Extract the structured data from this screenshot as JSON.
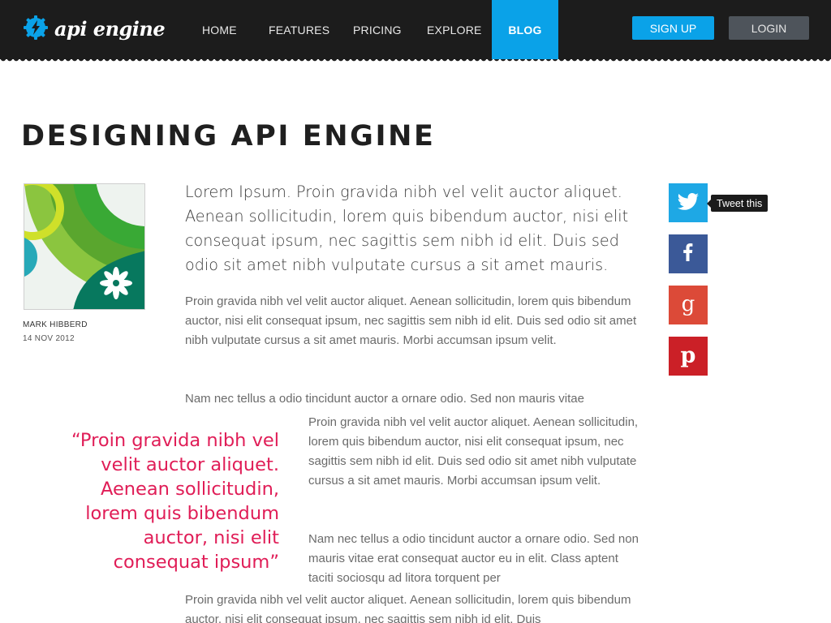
{
  "header": {
    "logo_text": "api engine",
    "nav": [
      {
        "label": "HOME"
      },
      {
        "label": "FEATURES"
      },
      {
        "label": "PRICING"
      },
      {
        "label": "EXPLORE"
      },
      {
        "label": "BLOG",
        "active": true
      }
    ],
    "signup_label": "SIGN UP",
    "login_label": "LOGIN"
  },
  "article": {
    "title": "DESIGNING API ENGINE",
    "author": "MARK HIBBERD",
    "date": "14 NOV 2012",
    "lead": "Lorem Ipsum. Proin gravida nibh vel velit auctor aliquet. Aenean sollicitudin, lorem quis bibendum auctor, nisi elit consequat ipsum, nec sagittis sem nibh id elit. Duis sed odio sit amet nibh vulputate cursus a sit amet mauris.",
    "paragraphs": [
      "Proin gravida nibh vel velit auctor aliquet. Aenean sollicitudin, lorem quis bibendum auctor, nisi elit consequat ipsum, nec sagittis sem nibh id elit. Duis sed odio sit amet nibh vulputate cursus a sit amet mauris. Morbi accumsan ipsum velit.",
      "Nam nec tellus a odio tincidunt auctor a ornare odio. Sed non  mauris vitae",
      "Proin gravida nibh vel velit auctor aliquet. Aenean sollicitudin, lorem quis bibendum auctor, nisi elit consequat ipsum, nec sagittis sem nibh id elit. Duis sed odio sit amet nibh vulputate cursus a sit amet mauris. Morbi accumsan ipsum velit.",
      "Nam nec tellus a odio tincidunt auctor a ornare odio. Sed non  mauris vitae erat consequat auctor eu in elit. Class aptent taciti sociosqu ad litora torquent per",
      "Proin gravida nibh vel velit auctor aliquet. Aenean sollicitudin, lorem quis bibendum auctor, nisi elit consequat ipsum, nec sagittis sem nibh id elit. Duis"
    ],
    "pullquote": "“Proin gravida nibh vel velit auctor aliquet. Aenean sollicitudin, lorem quis bibendum auctor, nisi elit consequat ipsum”"
  },
  "social": {
    "tooltip": "Tweet this",
    "icons": [
      "twitter-icon",
      "facebook-icon",
      "google-plus-icon",
      "pinterest-icon"
    ],
    "colors": {
      "twitter": "#1ea8e5",
      "facebook": "#3b5998",
      "google": "#dc4a38",
      "pinterest": "#cb2027"
    }
  },
  "colors": {
    "accent": "#0aa2e8",
    "quote": "#e01d57",
    "header_bg": "#1c1c1c"
  }
}
